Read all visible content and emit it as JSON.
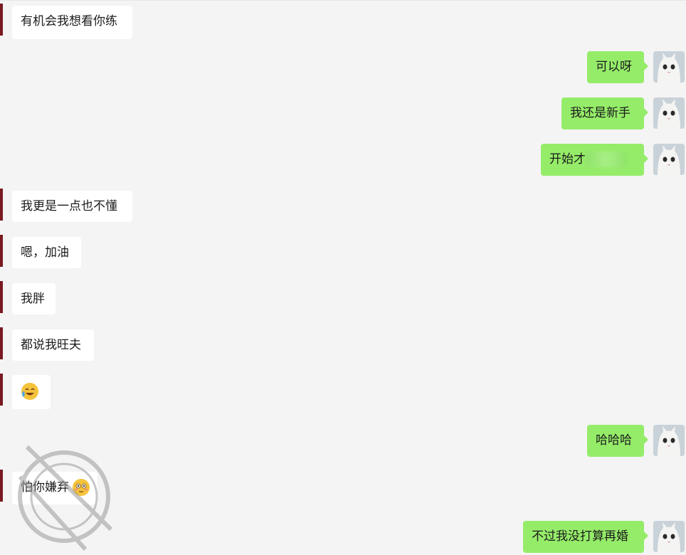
{
  "messages": [
    {
      "side": "left",
      "text": "有机会我想看你练"
    },
    {
      "side": "right",
      "text": "可以呀"
    },
    {
      "side": "right",
      "text": "我还是新手"
    },
    {
      "side": "right",
      "text": "开始才"
    },
    {
      "side": "left",
      "text": "我更是一点也不懂"
    },
    {
      "side": "left",
      "text": "嗯，加油"
    },
    {
      "side": "left",
      "text": "我胖"
    },
    {
      "side": "left",
      "text": "都说我旺夫"
    },
    {
      "side": "left",
      "text": "",
      "emoji": "laughing-crying-emoji"
    },
    {
      "side": "right",
      "text": "哈哈哈"
    },
    {
      "side": "left",
      "text": "怕你嫌弃",
      "emoji": "flushed-emoji"
    },
    {
      "side": "right",
      "text": "不过我没打算再婚"
    }
  ],
  "colors": {
    "background": "#f4f4f4",
    "sent_bubble": "#95ec69",
    "received_bubble": "#ffffff",
    "accent": "#7a1a22"
  },
  "avatar_icon": "cat-avatar-icon",
  "watermark_icon": "watermark-stamp-icon"
}
